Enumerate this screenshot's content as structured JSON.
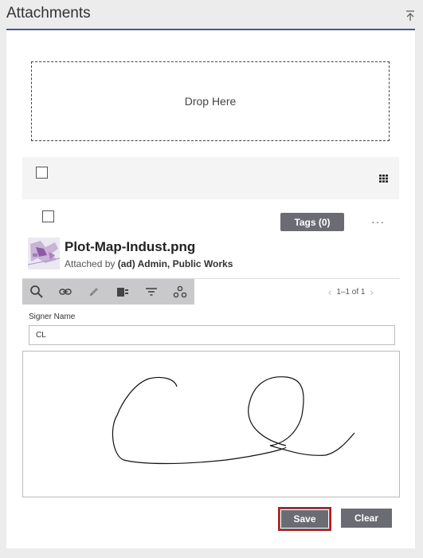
{
  "header": {
    "title": "Attachments"
  },
  "dropzone": {
    "label": "Drop Here"
  },
  "attachment": {
    "tags_label": "Tags (0)",
    "more_label": "···",
    "file_name": "Plot-Map-Indust.png",
    "attached_prefix": "Attached by",
    "attached_by": "(ad) Admin, Public Works"
  },
  "toolbar": {
    "tools": [
      "search-icon",
      "link-icon",
      "pencil-icon",
      "move-icon",
      "filter-icon",
      "share-icon"
    ],
    "pager_text": "1–1 of 1"
  },
  "signer": {
    "label": "Signer Name",
    "value": "CL"
  },
  "buttons": {
    "save_label": "Save",
    "clear_label": "Clear"
  },
  "colors": {
    "header_rule": "#4a5a8a",
    "button_bg": "#6b6b73",
    "focus_border": "#b01e1e"
  }
}
